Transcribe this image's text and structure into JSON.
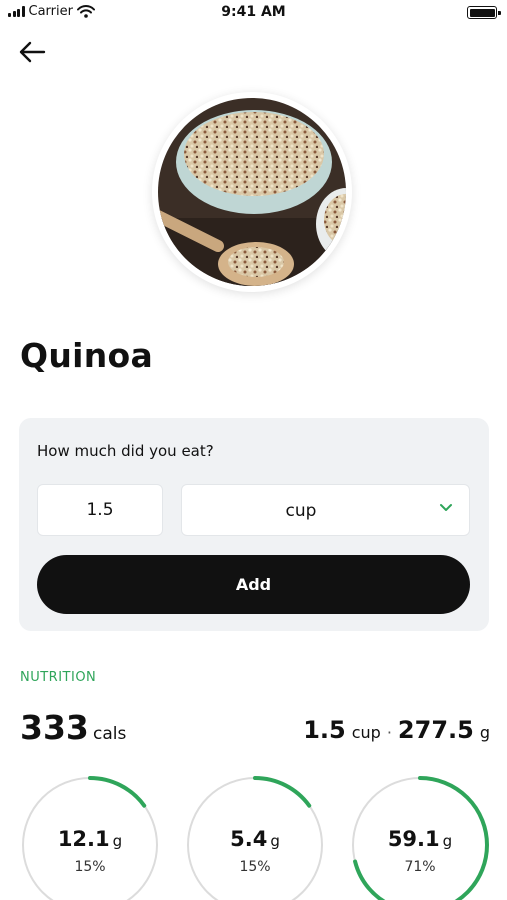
{
  "status_bar": {
    "carrier": "Carrier",
    "time": "9:41 AM"
  },
  "food": {
    "name": "Quinoa",
    "image_icon": "quinoa-bowl-photo"
  },
  "amount": {
    "question": "How much did you eat?",
    "quantity": "1.5",
    "unit": "cup",
    "add_label": "Add"
  },
  "nutrition": {
    "heading": "NUTRITION",
    "calories": "333",
    "calories_unit": "cals",
    "serving_qty": "1.5",
    "serving_unit": "cup",
    "serving_separator": "·",
    "weight": "277.5",
    "weight_unit": "g",
    "accent_color": "#2fa55a",
    "macros": [
      {
        "amount": "12.1",
        "unit": "g",
        "percent": "15%",
        "fraction": 0.15
      },
      {
        "amount": "5.4",
        "unit": "g",
        "percent": "15%",
        "fraction": 0.15
      },
      {
        "amount": "59.1",
        "unit": "g",
        "percent": "71%",
        "fraction": 0.71
      }
    ]
  }
}
